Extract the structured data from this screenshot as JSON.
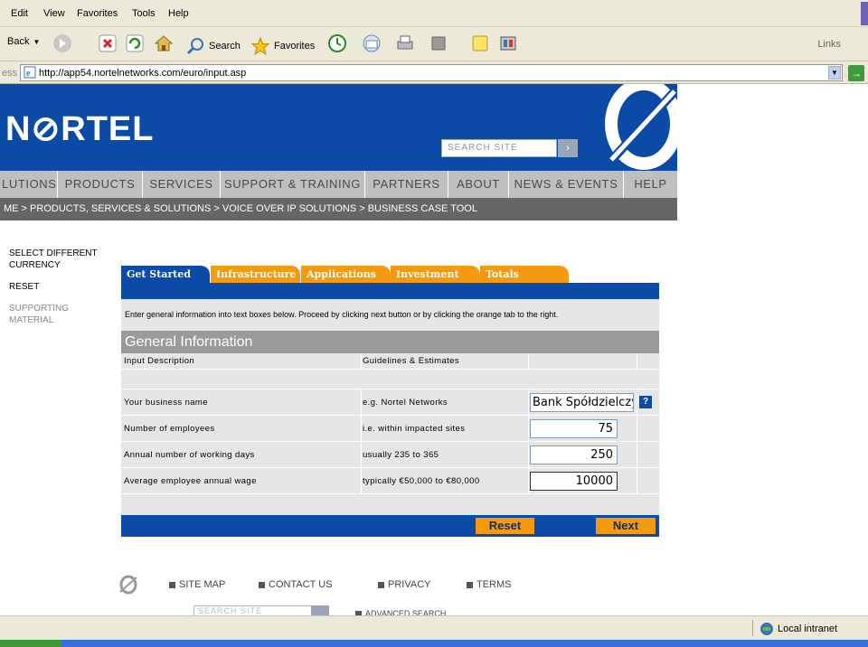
{
  "browser": {
    "menu": [
      "Edit",
      "View",
      "Favorites",
      "Tools",
      "Help"
    ],
    "toolbar": {
      "back_label": "Back",
      "search_label": "Search",
      "favorites_label": "Favorites",
      "links_label": "Links"
    },
    "address": {
      "label": "ess",
      "url": "http://app54.nortelnetworks.com/euro/input.asp"
    },
    "status": {
      "zone": "Local intranet"
    }
  },
  "header": {
    "logo": "N⊘RTEL",
    "search_placeholder": "SEARCH SITE",
    "search_go": "›"
  },
  "nav": [
    "LUTIONS",
    "PRODUCTS",
    "SERVICES",
    "SUPPORT & TRAINING",
    "PARTNERS",
    "ABOUT",
    "NEWS & EVENTS",
    "HELP"
  ],
  "breadcrumb": "ME > PRODUCTS, SERVICES & SOLUTIONS > VOICE OVER IP SOLUTIONS > BUSINESS CASE TOOL",
  "left_links": {
    "currency": "SELECT DIFFERENT CURRENCY",
    "reset": "RESET",
    "supporting": "SUPPORTING MATERIAL"
  },
  "tabs": [
    "Get Started",
    "Infrastructure",
    "Applications",
    "Investment",
    "Totals"
  ],
  "instructions": "Enter general information into text boxes below. Proceed by clicking next button or by clicking the orange tab to the right.",
  "section_title": "General Information",
  "table": {
    "col_input": "Input Description",
    "col_guide": "Guidelines & Estimates",
    "rows": [
      {
        "label": "Your business name",
        "guide": "e.g. Nortel Networks",
        "value": "Bank Spółdzielczy"
      },
      {
        "label": "Number of employees",
        "guide": "i.e. within impacted sites",
        "value": "75"
      },
      {
        "label": "Annual number of working days",
        "guide": "usually 235 to 365",
        "value": "250"
      },
      {
        "label": "Average employee annual wage",
        "guide": "typically €50,000 to €80,000",
        "value": "10000"
      }
    ],
    "help_icon": "?"
  },
  "buttons": {
    "reset": "Reset",
    "next": "Next"
  },
  "footer": {
    "site_map": "SITE MAP",
    "contact": "CONTACT US",
    "privacy": "PRIVACY",
    "terms": "TERMS",
    "search_placeholder": "SEARCH SITE",
    "advanced": "ADVANCED SEARCH"
  },
  "colors": {
    "brand_blue": "#0b4ba5",
    "tab_orange": "#f39a10",
    "tab_active": "#0b4ba5"
  }
}
